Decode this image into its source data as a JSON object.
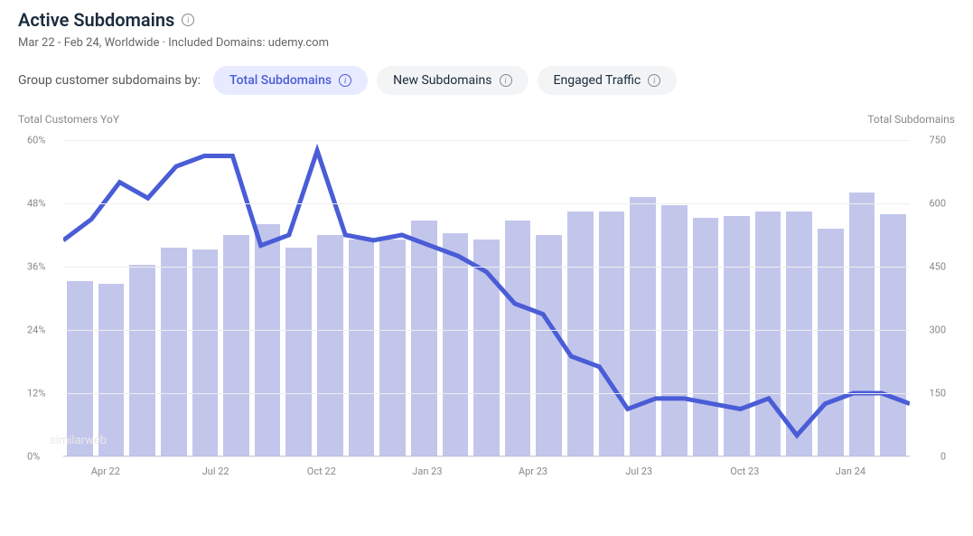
{
  "header": {
    "title": "Active Subdomains",
    "subtitle": "Mar 22 - Feb 24, Worldwide · Included Domains: udemy.com"
  },
  "tabbar": {
    "label": "Group customer subdomains by:",
    "tabs": [
      {
        "label": "Total Subdomains",
        "active": true
      },
      {
        "label": "New Subdomains",
        "active": false
      },
      {
        "label": "Engaged Traffic",
        "active": false
      }
    ]
  },
  "axes": {
    "left_title": "Total Customers YoY",
    "right_title": "Total Subdomains",
    "left_ticks": [
      "60%",
      "48%",
      "36%",
      "24%",
      "12%",
      "0%"
    ],
    "right_ticks": [
      "750",
      "600",
      "450",
      "300",
      "150",
      "0"
    ],
    "x_ticks": [
      {
        "label": "Apr 22",
        "pos": 5
      },
      {
        "label": "Jul 22",
        "pos": 18
      },
      {
        "label": "Oct 22",
        "pos": 30.5
      },
      {
        "label": "Jan 23",
        "pos": 43
      },
      {
        "label": "Apr 23",
        "pos": 55.5
      },
      {
        "label": "Jul 23",
        "pos": 68
      },
      {
        "label": "Oct 23",
        "pos": 80.5
      },
      {
        "label": "Jan 24",
        "pos": 93
      }
    ]
  },
  "chart_data": {
    "type": "bar+line",
    "x": [
      "Mar 22",
      "Apr 22",
      "May 22",
      "Jun 22",
      "Jul 22",
      "Aug 22",
      "Sep 22",
      "Oct 22",
      "Nov 22",
      "Dec 22",
      "Jan 23",
      "Feb 23",
      "Mar 23",
      "Apr 23",
      "May 23",
      "Jun 23",
      "Jul 23",
      "Aug 23",
      "Sep 23",
      "Oct 23",
      "Nov 23",
      "Dec 23",
      "Jan 24",
      "Feb 24"
    ],
    "series": [
      {
        "name": "Total Subdomains",
        "type": "bar",
        "axis": "right",
        "values": [
          415,
          410,
          455,
          495,
          490,
          525,
          550,
          495,
          525,
          515,
          515,
          560,
          530,
          515,
          560,
          525,
          580,
          580,
          615,
          595,
          565,
          570,
          580,
          580,
          540,
          625,
          575
        ]
      },
      {
        "name": "Total Customers YoY",
        "type": "line",
        "axis": "left",
        "values": [
          41,
          45,
          52,
          49,
          55,
          57,
          57,
          40,
          42,
          58,
          42,
          41,
          42,
          40,
          38,
          35,
          29,
          27,
          19,
          17,
          9,
          11,
          11,
          10,
          9,
          11,
          4,
          10,
          12,
          12,
          10
        ]
      }
    ],
    "left_range": [
      0,
      60
    ],
    "right_range": [
      0,
      750
    ]
  },
  "watermark": "similarweb"
}
